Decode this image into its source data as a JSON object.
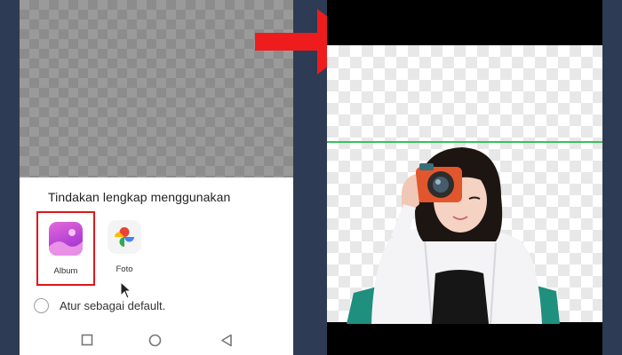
{
  "left_phone": {
    "sheet_title": "Tindakan lengkap menggunakan",
    "apps": [
      {
        "label": "Album",
        "icon": "album-gallery-icon",
        "selected": true
      },
      {
        "label": "Foto",
        "icon": "google-photos-pinwheel-icon",
        "selected": false
      }
    ],
    "default_option_label": "Atur sebagai default.",
    "nav": [
      "square-recents-icon",
      "circle-home-icon",
      "triangle-back-icon"
    ]
  },
  "colors": {
    "highlight_border": "#e0161b",
    "arrow": "#ee1c1c",
    "crop_line": "#39c15a",
    "background": "#2e3b54"
  }
}
